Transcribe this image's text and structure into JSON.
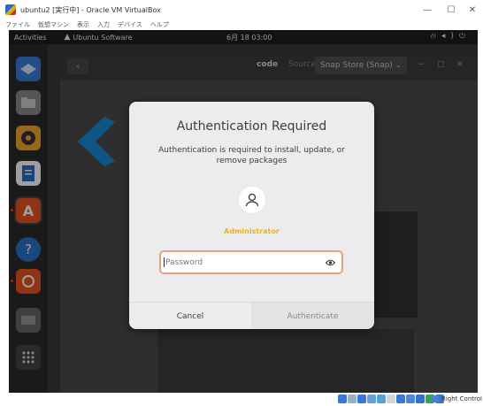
{
  "host": {
    "window_title": "ubuntu2 [実行中] - Oracle VM VirtualBox",
    "menu": [
      "ファイル",
      "仮想マシン",
      "表示",
      "入力",
      "デバイス",
      "ヘルプ"
    ],
    "window_controls": {
      "minimize": "—",
      "maximize": "☐",
      "close": "✕"
    },
    "host_key_label": "Right Control",
    "status_icon_colors": [
      "#3a78d8",
      "#9ab0c8",
      "#3a78d8",
      "#6a9ed8",
      "#58a0d8",
      "#cfd6dc",
      "#3a78d8",
      "#4a88d8",
      "#3a6ec8",
      "#2fa84f",
      "#3a78d8"
    ]
  },
  "gnome": {
    "activities": "Activities",
    "app_menu": "Ubuntu Software",
    "app_menu_icon": "ubuntu-software-icon",
    "clock": "6月 18 03:00",
    "tray": {
      "network": "⛙",
      "volume": "◂)",
      "power": "⏻"
    }
  },
  "dock": {
    "apps": [
      {
        "name": "thunderbird-icon",
        "color": "#3b7dd8"
      },
      {
        "name": "files-icon",
        "color": "#8a8a8a"
      },
      {
        "name": "rhythmbox-icon",
        "color": "#f0a830"
      },
      {
        "name": "writer-icon",
        "color": "#2b6cc8"
      },
      {
        "name": "ubuntu-software-icon",
        "color": "#e95420"
      },
      {
        "name": "help-icon",
        "color": "#2a73c9"
      },
      {
        "name": "ubuntu-update-icon",
        "color": "#e95420"
      },
      {
        "name": "system-icon",
        "color": "#666666"
      },
      {
        "name": "show-apps-icon",
        "color": "#444444"
      }
    ]
  },
  "software": {
    "back": "‹",
    "app_name": "code",
    "source_label": "Source",
    "source_value": "Snap Store (Snap)",
    "minimize": "−",
    "maximize": "□",
    "close": "✕"
  },
  "dialog": {
    "title": "Authentication Required",
    "message": "Authentication is required to install, update, or remove packages",
    "user": "Administrator",
    "password_placeholder": "Password",
    "cancel_label": "Cancel",
    "authenticate_label": "Authenticate",
    "accent_color": "#e9a07d",
    "user_color": "#e9b12a"
  }
}
